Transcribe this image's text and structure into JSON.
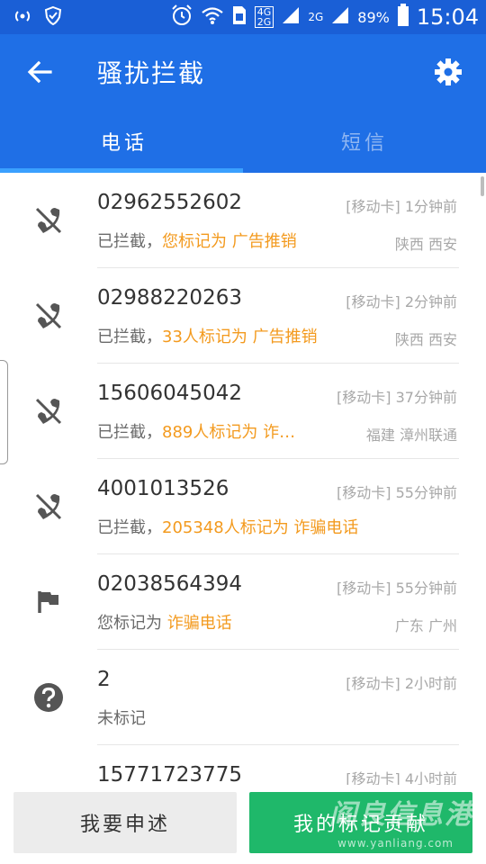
{
  "status_bar": {
    "net_top": "4G",
    "net_bottom": "2G",
    "net_2g": "2G",
    "battery_pct": "89%",
    "time": "15:04"
  },
  "app_bar": {
    "title": "骚扰拦截"
  },
  "tabs": [
    {
      "label": "电话",
      "active": true
    },
    {
      "label": "短信",
      "active": false
    }
  ],
  "rows": [
    {
      "icon": "call-blocked-icon",
      "number": "02962552602",
      "card": "[移动卡]",
      "time": "1分钟前",
      "status_prefix": "已拦截，",
      "status_tag": "您标记为 广告推销",
      "location": "陕西 西安"
    },
    {
      "icon": "call-blocked-icon",
      "number": "02988220263",
      "card": "[移动卡]",
      "time": "2分钟前",
      "status_prefix": "已拦截，",
      "status_tag": "33人标记为 广告推销",
      "location": "陕西 西安"
    },
    {
      "icon": "call-blocked-icon",
      "number": "15606045042",
      "card": "[移动卡]",
      "time": "37分钟前",
      "status_prefix": "已拦截，",
      "status_tag": "889人标记为 诈…",
      "location": "福建 漳州联通"
    },
    {
      "icon": "call-blocked-icon",
      "number": "4001013526",
      "card": "[移动卡]",
      "time": "55分钟前",
      "status_prefix": "已拦截，",
      "status_tag": "205348人标记为 诈骗电话",
      "location": ""
    },
    {
      "icon": "flag-icon",
      "number": "02038564394",
      "card": "[移动卡]",
      "time": "55分钟前",
      "status_prefix": "您标记为 ",
      "status_tag": "诈骗电话",
      "location": "广东 广州"
    },
    {
      "icon": "question-icon",
      "number": "2",
      "card": "[移动卡]",
      "time": "2小时前",
      "status_prefix": "未标记",
      "status_tag": "",
      "location": ""
    },
    {
      "icon": "minus-icon",
      "number": "15771723775",
      "card": "[移动卡]",
      "time": "4小时前",
      "status_prefix": "",
      "status_tag": "",
      "location": ""
    }
  ],
  "bottom": {
    "appeal_label": "我要申述",
    "contribution_label": "我的标记贡献"
  },
  "watermark": {
    "text": "阎良信息港",
    "url": "www.yanliang.com"
  },
  "colors": {
    "primary": "#1f6fe6",
    "status_bar": "#1a5fd6",
    "accent_orange": "#f39a1e",
    "green": "#1fb86a"
  }
}
